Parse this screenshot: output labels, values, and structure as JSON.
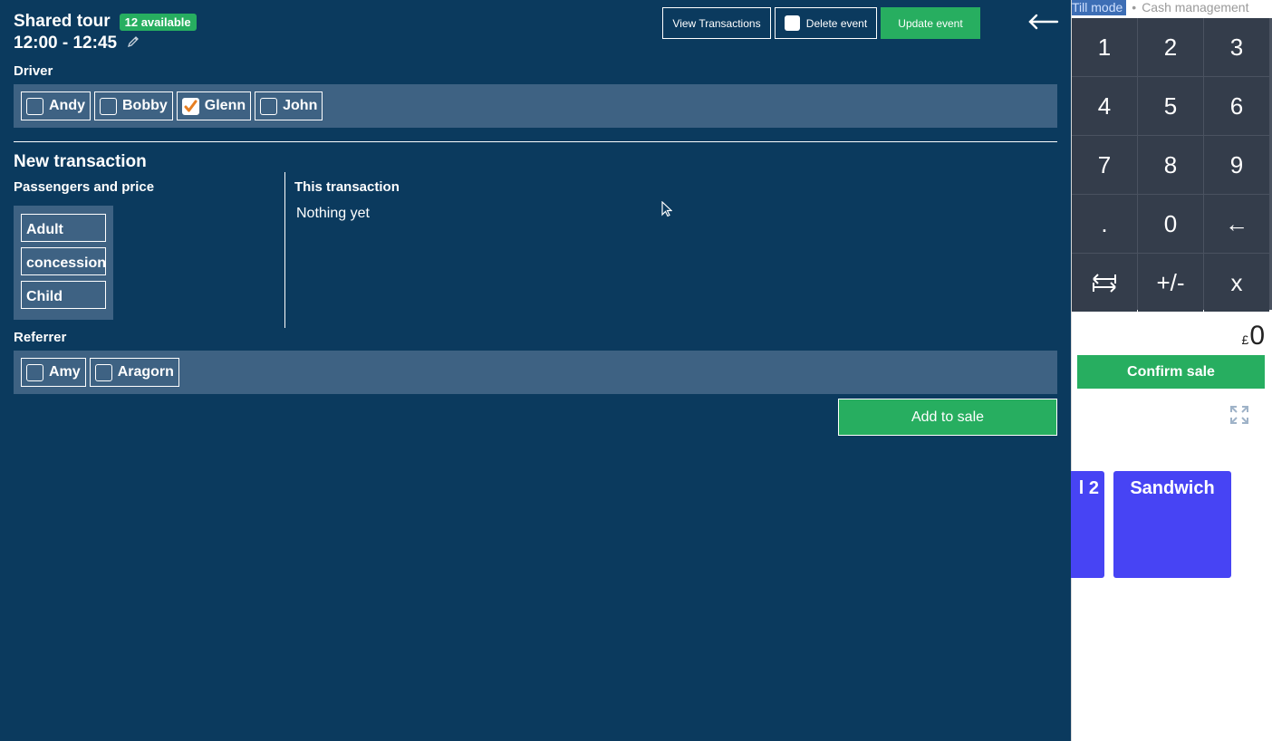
{
  "pos": {
    "till_mode": "Till mode",
    "separator": "•",
    "cash_management": "Cash management",
    "keys": [
      "1",
      "2",
      "3",
      "4",
      "5",
      "6",
      "7",
      "8",
      "9",
      ".",
      "0",
      "←",
      "",
      "+/-",
      "x"
    ],
    "key_names": [
      "key-1",
      "key-2",
      "key-3",
      "key-4",
      "key-5",
      "key-6",
      "key-7",
      "key-8",
      "key-9",
      "key-decimal",
      "key-0",
      "key-backspace",
      "key-tab",
      "key-plus-minus",
      "key-clear"
    ],
    "currency": "£",
    "total": "0",
    "confirm_label": "Confirm sale",
    "tiles": [
      {
        "label": "l 2"
      },
      {
        "label": "Sandwich"
      }
    ],
    "tile_color": "#4744f4"
  },
  "event": {
    "title": "Shared tour",
    "available_badge": "12 available",
    "time": "12:00 - 12:45",
    "buttons": {
      "view_transactions": "View Transactions",
      "delete_event": "Delete event",
      "update_event": "Update event"
    }
  },
  "driver": {
    "label": "Driver",
    "options": [
      {
        "name": "Andy",
        "checked": false
      },
      {
        "name": "Bobby",
        "checked": false
      },
      {
        "name": "Glenn",
        "checked": true
      },
      {
        "name": "John",
        "checked": false
      }
    ]
  },
  "transaction": {
    "heading": "New transaction",
    "passengers_label": "Passengers and price",
    "price_types": [
      "Adult",
      "concession",
      "Child"
    ],
    "this_transaction_label": "This transaction",
    "empty_text": "Nothing yet"
  },
  "referrer": {
    "label": "Referrer",
    "options": [
      {
        "name": "Amy",
        "checked": false
      },
      {
        "name": "Aragorn",
        "checked": false
      }
    ]
  },
  "add_to_sale_label": "Add to sale",
  "colors": {
    "panel_bg": "#0b3a5e",
    "strip_bg": "#3e6283",
    "accent_green": "#27ae60",
    "check_orange": "#e67e22",
    "keypad_key": "#343d4b"
  }
}
